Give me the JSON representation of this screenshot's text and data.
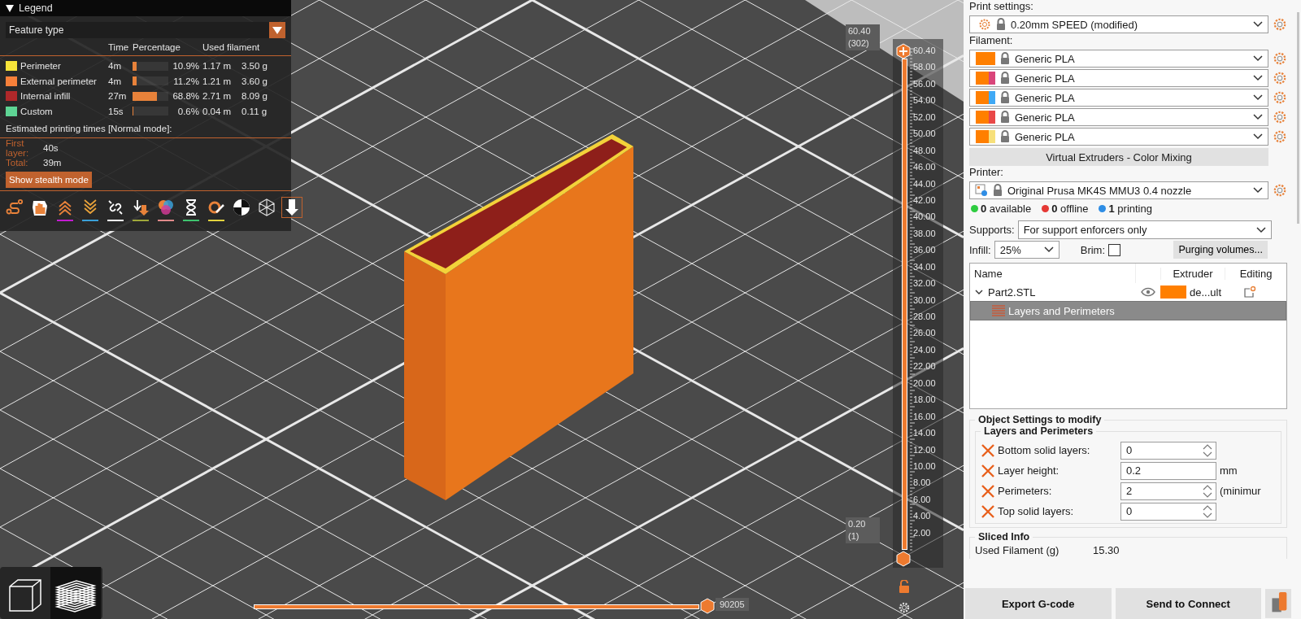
{
  "legend": {
    "title": "Legend",
    "expanded": true,
    "view_type": "Feature type",
    "columns": [
      "Time",
      "Percentage",
      "Used filament"
    ],
    "features": [
      {
        "name": "Perimeter",
        "color": "#f7e43a",
        "time": "4m",
        "level": 0.109,
        "percentage": "10.9%",
        "length": "1.17 m",
        "weight": "3.50 g"
      },
      {
        "name": "External perimeter",
        "color": "#f7803a",
        "time": "4m",
        "level": 0.112,
        "percentage": "11.2%",
        "length": "1.21 m",
        "weight": "3.60 g"
      },
      {
        "name": "Internal infill",
        "color": "#b0282a",
        "time": "27m",
        "level": 0.688,
        "percentage": "68.8%",
        "length": "2.71 m",
        "weight": "8.09 g"
      },
      {
        "name": "Custom",
        "color": "#5ed494",
        "time": "15s",
        "level": 0.006,
        "percentage": "0.6%",
        "length": "0.04 m",
        "weight": "0.11 g"
      }
    ],
    "estimate_title": "Estimated printing times [Normal mode]:",
    "times": [
      {
        "label": "First layer:",
        "value": "40s"
      },
      {
        "label": "Total:",
        "value": "39m"
      }
    ],
    "stealth_button": "Show stealth mode",
    "toolbar": [
      {
        "kind": "route",
        "selected": false
      },
      {
        "kind": "hand",
        "selected": false
      },
      {
        "kind": "chevrons-up",
        "selected": false,
        "color": "#c21bd1"
      },
      {
        "kind": "chevrons-down",
        "selected": false,
        "color": "#3aa0d8"
      },
      {
        "kind": "broken-link",
        "selected": false,
        "color": "#ffffff"
      },
      {
        "kind": "arrows-down",
        "selected": false,
        "color": "#a0a83a"
      },
      {
        "kind": "color-circles",
        "selected": false,
        "color": "#e08a8a"
      },
      {
        "kind": "hourglass",
        "selected": false,
        "color": "#3ec36e"
      },
      {
        "kind": "gear-pencil",
        "selected": false,
        "color": "#e3d23e"
      },
      {
        "kind": "target",
        "selected": false
      },
      {
        "kind": "wireframe-cube",
        "selected": false
      },
      {
        "kind": "arrow-down",
        "selected": true
      }
    ]
  },
  "vertical_slider": {
    "upper": {
      "value": "60.40",
      "layer": "(302)",
      "level": 1
    },
    "lower": {
      "value": "0.20",
      "layer": "(1)",
      "level": 0
    },
    "ticks": [
      "60.40",
      "58.00",
      "56.00",
      "54.00",
      "52.00",
      "50.00",
      "48.00",
      "46.00",
      "44.00",
      "42.00",
      "40.00",
      "38.00",
      "36.00",
      "34.00",
      "32.00",
      "30.00",
      "28.00",
      "26.00",
      "24.00",
      "22.00",
      "20.00",
      "18.00",
      "16.00",
      "14.00",
      "12.00",
      "10.00",
      "8.00",
      "6.00",
      "4.00",
      "2.00"
    ]
  },
  "horizontal_slider": {
    "level": 1,
    "value": "90205"
  },
  "view_buttons": [
    {
      "kind": "cube",
      "selected": false
    },
    {
      "kind": "layers",
      "selected": true
    }
  ],
  "print_settings": {
    "label": "Print settings:",
    "value": "0.20mm SPEED (modified)"
  },
  "filament": {
    "label": "Filament:",
    "items": [
      {
        "swatches": [
          {
            "color": "#ff7f00"
          }
        ],
        "name": "Generic PLA"
      },
      {
        "swatches": [
          {
            "color": "#ff7f00"
          },
          {
            "color": "#d9457a"
          }
        ],
        "name": "Generic PLA"
      },
      {
        "swatches": [
          {
            "color": "#ff7f00"
          },
          {
            "color": "#3fa9f5"
          }
        ],
        "name": "Generic PLA"
      },
      {
        "swatches": [
          {
            "color": "#ff7f00"
          },
          {
            "color": "#e94848"
          }
        ],
        "name": "Generic PLA"
      },
      {
        "swatches": [
          {
            "color": "#ff7f00"
          },
          {
            "color": "#f7e07a"
          }
        ],
        "name": "Generic PLA"
      }
    ]
  },
  "color_mixing_button": "Virtual Extruders - Color Mixing",
  "printer": {
    "label": "Printer:",
    "value": "Original Prusa MK4S MMU3 0.4 nozzle",
    "status": [
      {
        "count": "0",
        "label": "available",
        "color": "#2ecc40"
      },
      {
        "count": "0",
        "label": "offline",
        "color": "#e53935"
      },
      {
        "count": "1",
        "label": "printing",
        "color": "#2e8de5"
      }
    ]
  },
  "supports": {
    "label": "Supports:",
    "value": "For support enforcers only"
  },
  "infill": {
    "label": "Infill:",
    "value": "25%"
  },
  "brim": {
    "label": "Brim:",
    "checked": false
  },
  "purging_button": "Purging volumes...",
  "object_list": {
    "columns": [
      "Name",
      "Extruder",
      "Editing"
    ],
    "objects": [
      {
        "name": "Part2.STL",
        "expanded": true,
        "visible": true,
        "extruder_swatch": {
          "color": "#ff7f00"
        },
        "extruder": "de...ult",
        "children": [
          {
            "name": "Layers and Perimeters",
            "selected": true
          }
        ]
      }
    ]
  },
  "object_settings": {
    "title": "Object Settings to modify",
    "group": "Layers and Perimeters",
    "options": [
      {
        "kind": "spin",
        "label": "Bottom solid layers:",
        "value": "0"
      },
      {
        "kind": "text",
        "label": "Layer height:",
        "value": "0.2",
        "unit": "mm"
      },
      {
        "kind": "spin",
        "label": "Perimeters:",
        "value": "2",
        "unit": "(minimur"
      },
      {
        "kind": "spin",
        "label": "Top solid layers:",
        "value": "0"
      }
    ]
  },
  "sliced_info": {
    "title": "Sliced Info",
    "rows": [
      {
        "label": "Used Filament (g)",
        "value": "15.30"
      }
    ]
  },
  "actions": [
    "Export G-code",
    "Send to Connect"
  ]
}
